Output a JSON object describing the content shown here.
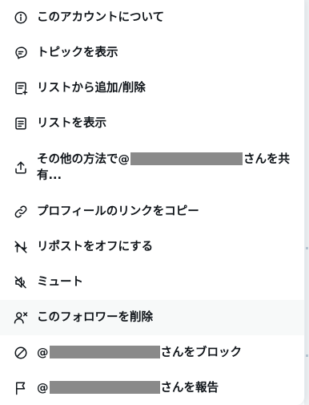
{
  "menu": {
    "items": [
      {
        "name": "about-account",
        "icon": "info-circle-icon",
        "label": "このアカウントについて"
      },
      {
        "name": "view-topics",
        "icon": "topic-bubble-icon",
        "label": "トピックを表示"
      },
      {
        "name": "add-remove-lists",
        "icon": "list-add-icon",
        "label": "リストから追加/削除"
      },
      {
        "name": "view-lists",
        "icon": "list-icon",
        "label": "リストを表示"
      },
      {
        "name": "share-via",
        "icon": "share-icon",
        "prefix": "その他の方法で@",
        "suffix": "さんを共有..."
      },
      {
        "name": "copy-profile-link",
        "icon": "link-icon",
        "label": "プロフィールのリンクをコピー"
      },
      {
        "name": "turn-off-reposts",
        "icon": "repost-off-icon",
        "label": "リポストをオフにする"
      },
      {
        "name": "mute",
        "icon": "mute-icon",
        "label": "ミュート"
      },
      {
        "name": "remove-follower",
        "icon": "remove-follower-icon",
        "label": "このフォロワーを削除",
        "hovered": true
      },
      {
        "name": "block",
        "icon": "block-icon",
        "prefix": "@",
        "suffix": "さんをブロック"
      },
      {
        "name": "report",
        "icon": "flag-icon",
        "prefix": "@",
        "suffix": "さんを報告"
      }
    ]
  },
  "colors": {
    "text": "#0f1419",
    "hover_background": "#f7f9f9",
    "redaction": "#8a8a8a"
  }
}
